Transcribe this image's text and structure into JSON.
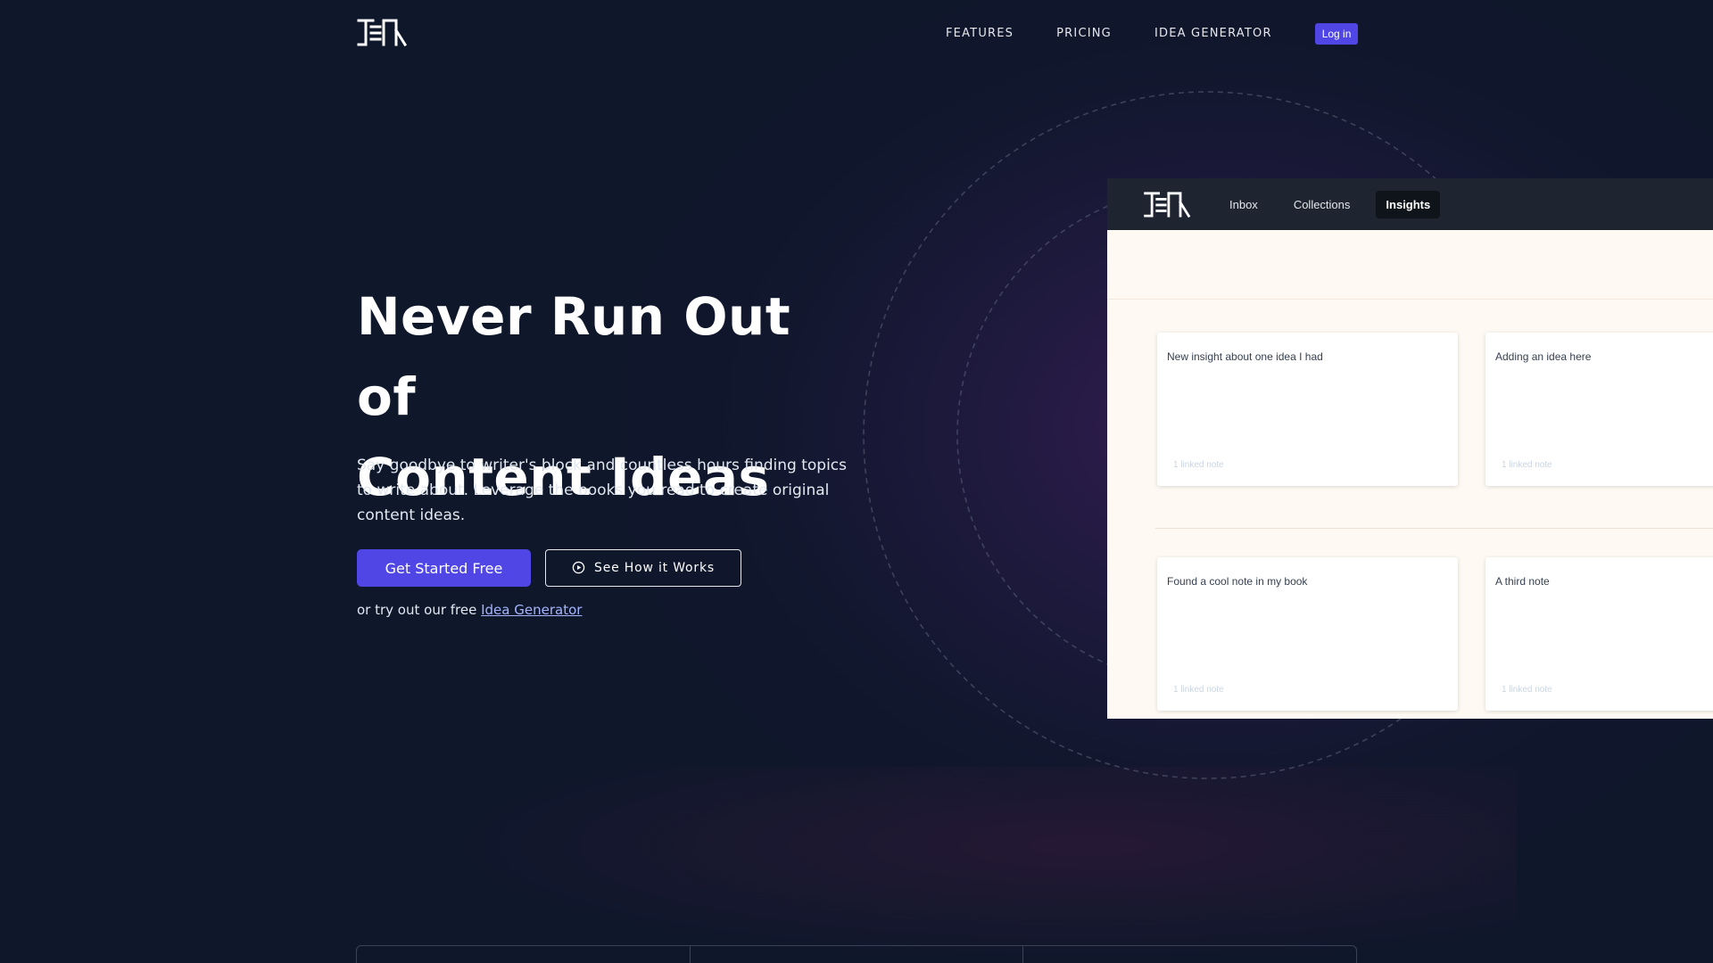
{
  "brand": {
    "logo_text": "TEN"
  },
  "nav": {
    "items": [
      "FEATURES",
      "PRICING",
      "IDEA GENERATOR"
    ],
    "login_label": "Log in"
  },
  "hero": {
    "title_line1": "Never Run Out of",
    "title_line2": "Content Ideas",
    "description": "Say goodbye to writer's block and countless hours finding topics to write about. Leverage the books you read to create original content ideas.",
    "primary_cta": "Get Started Free",
    "secondary_cta": "See How it Works",
    "try_prefix": "or try out our free ",
    "try_link": "Idea Generator"
  },
  "app_preview": {
    "tabs": [
      "Inbox",
      "Collections",
      "Insights"
    ],
    "active_tab": "Insights",
    "notes": [
      {
        "title": "New insight about one idea I had",
        "linked": "1 linked note"
      },
      {
        "title": "Adding an idea here",
        "linked": "1 linked note"
      },
      {
        "title": "Found a cool note in my book",
        "linked": "1 linked note"
      },
      {
        "title": "A third note",
        "linked": "1 linked note"
      }
    ]
  },
  "colors": {
    "background": "#0f172b",
    "accent": "#4f46e5",
    "link": "#a5b4fc",
    "mock_bar": "#1e2530",
    "mock_canvas": "#fef9f3"
  }
}
